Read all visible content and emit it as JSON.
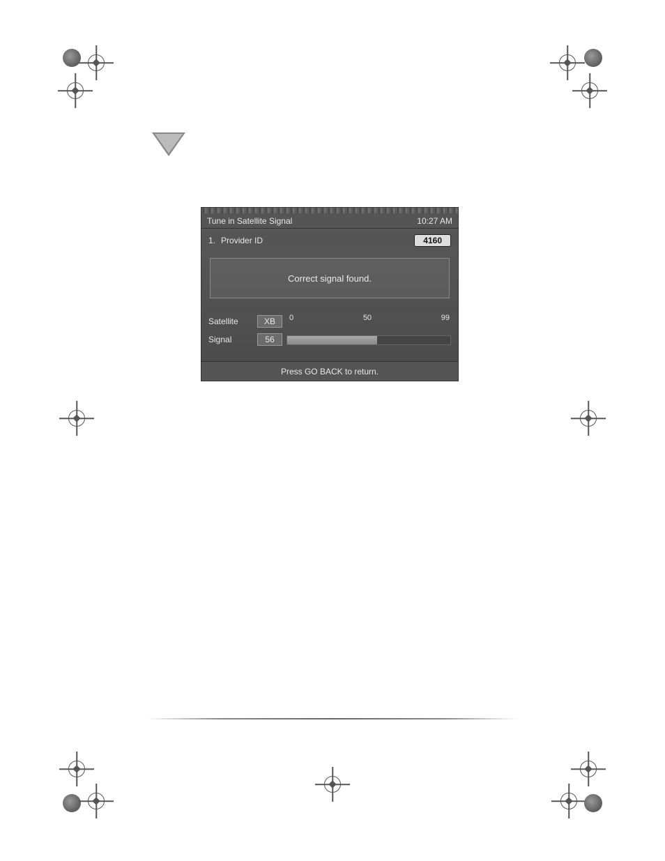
{
  "screenshot": {
    "title": "Tune in Satellite Signal",
    "time": "10:27 AM",
    "provider": {
      "index": "1.",
      "label": "Provider ID",
      "value": "4160"
    },
    "message": "Correct signal found.",
    "satellite": {
      "label": "Satellite",
      "value": "XB"
    },
    "signal": {
      "label": "Signal",
      "value": "56"
    },
    "scale": {
      "min": "0",
      "mid": "50",
      "max": "99"
    },
    "instruction": "Press GO BACK to return."
  }
}
